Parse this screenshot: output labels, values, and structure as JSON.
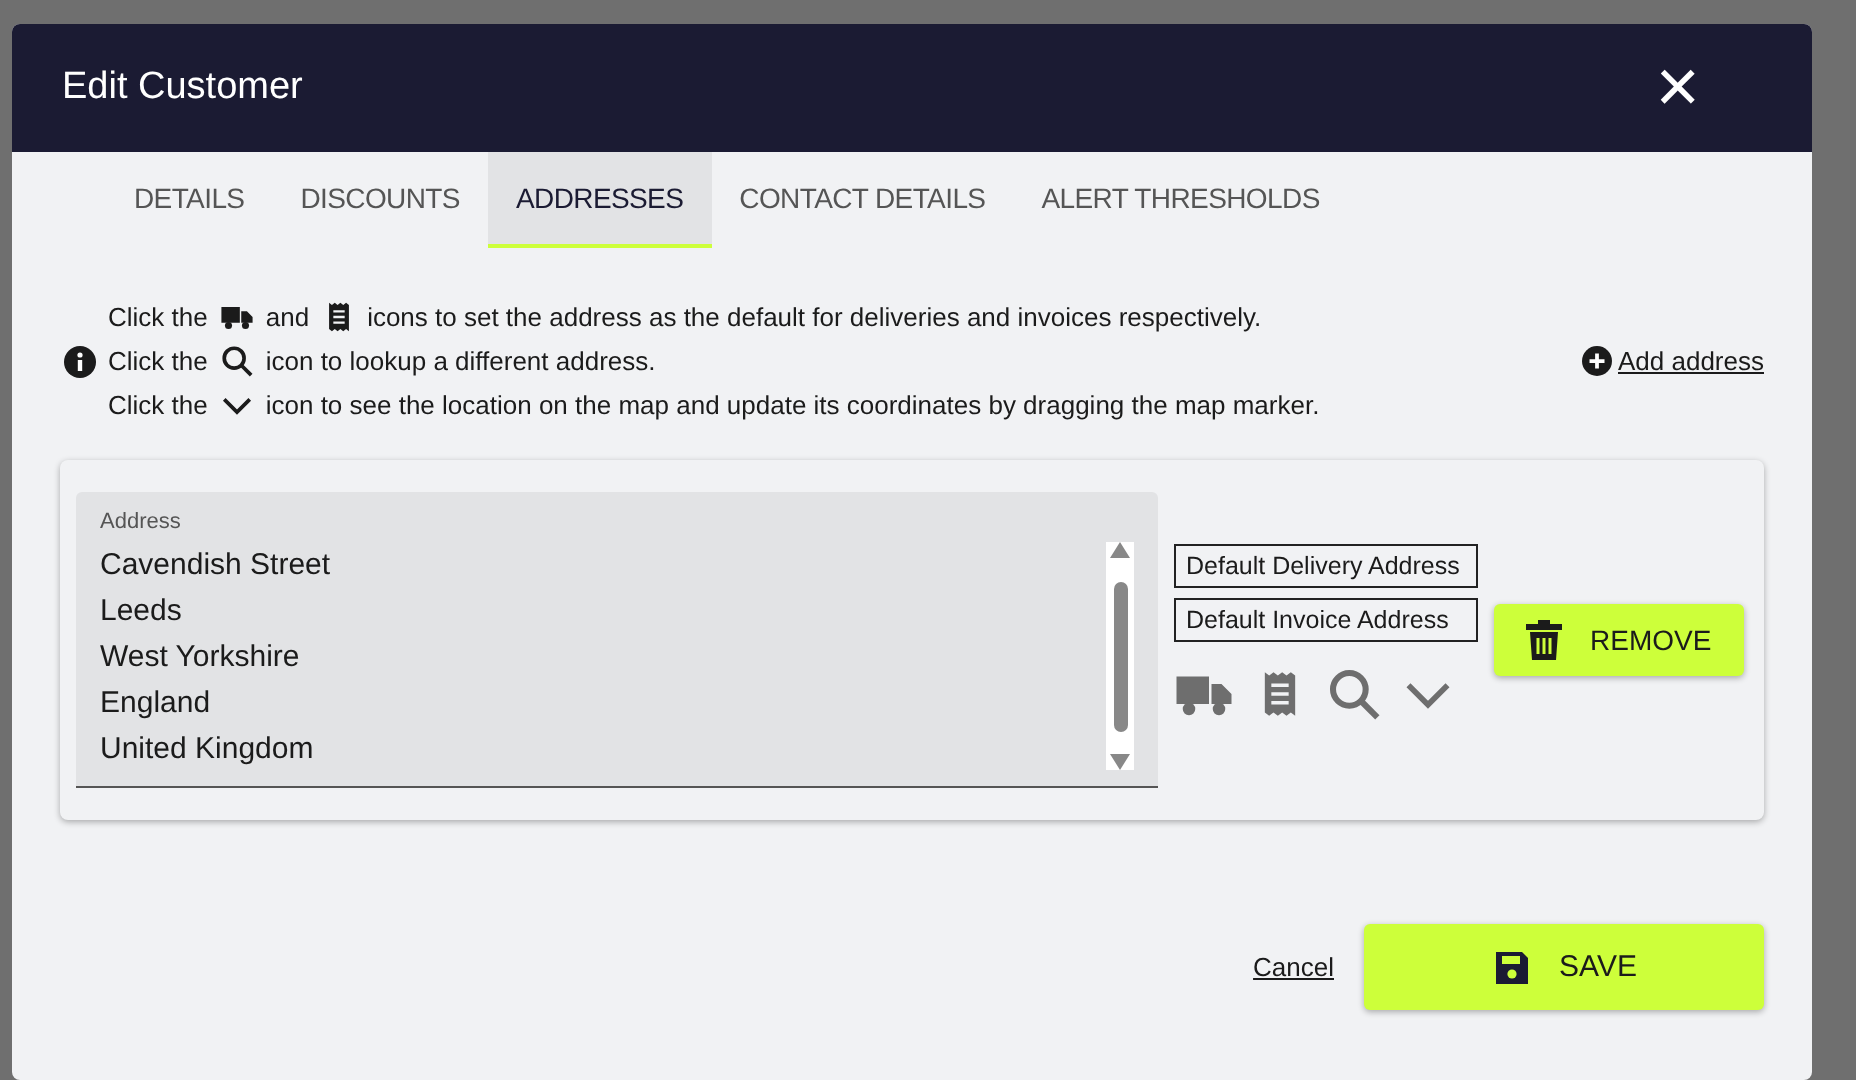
{
  "dialog": {
    "title": "Edit Customer",
    "close": "×"
  },
  "tabs": [
    {
      "label": "DETAILS",
      "selected": false
    },
    {
      "label": "DISCOUNTS",
      "selected": false
    },
    {
      "label": "ADDRESSES",
      "selected": true
    },
    {
      "label": "CONTACT DETAILS",
      "selected": false
    },
    {
      "label": "ALERT THRESHOLDS",
      "selected": false
    }
  ],
  "help": [
    [
      {
        "kind": "text",
        "text": "Click the"
      },
      {
        "kind": "truck"
      },
      {
        "kind": "text",
        "text": "and"
      },
      {
        "kind": "receipt"
      },
      {
        "kind": "text",
        "text": "icons to set the address as the default for deliveries and invoices respectively."
      }
    ],
    [
      {
        "kind": "text",
        "text": "Click the"
      },
      {
        "kind": "search"
      },
      {
        "kind": "text",
        "text": "icon to lookup a different address."
      }
    ],
    [
      {
        "kind": "text",
        "text": "Click the"
      },
      {
        "kind": "chevron"
      },
      {
        "kind": "text",
        "text": "icon to see the location on the map and update its coordinates by dragging the map marker."
      }
    ]
  ],
  "add_address": "Add address",
  "addresses": [
    {
      "label": "Address",
      "lines": [
        "Cavendish Street",
        "Leeds",
        "West Yorkshire",
        "England",
        "United Kingdom"
      ],
      "tags": [
        "Default Delivery Address",
        "Default Invoice Address"
      ],
      "remove": "REMOVE"
    }
  ],
  "cancel": "Cancel",
  "save": "SAVE"
}
